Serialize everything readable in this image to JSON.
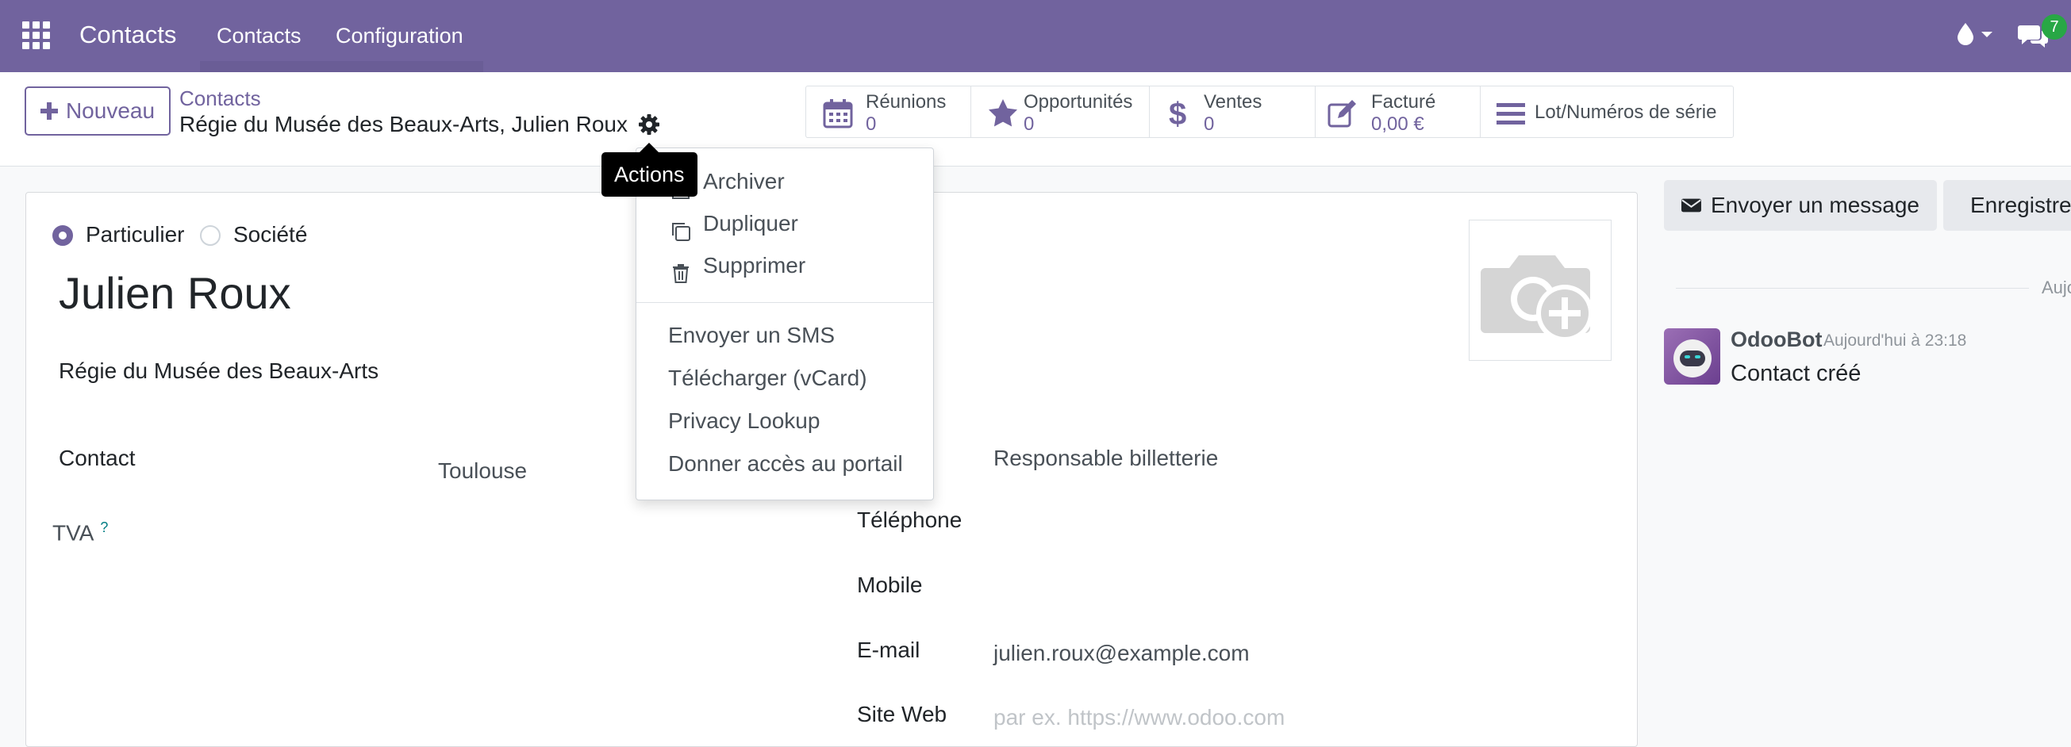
{
  "colors": {
    "brand": "#71639e",
    "text": "#212529",
    "muted": "#6c757d",
    "link": "#71639e"
  },
  "navbar": {
    "apps_icon": "grid-icon",
    "brand": "Contacts",
    "menus": [
      "Contacts",
      "Configuration"
    ],
    "activity_icon": "drop-icon",
    "messages_icon": "chat-icon",
    "messages_count": "7"
  },
  "control": {
    "new_label": "Nouveau",
    "breadcrumb_parent": "Contacts",
    "breadcrumb_current": "Régie du Musée des Beaux-Arts, Julien Roux",
    "gear_icon": "gear-icon",
    "smart_buttons": [
      {
        "label": "Réunions",
        "value": "0",
        "icon": "calendar-icon"
      },
      {
        "label": "Opportunités",
        "value": "0",
        "icon": "star-icon"
      },
      {
        "label": "Ventes",
        "value": "0",
        "icon": "dollar-icon"
      },
      {
        "label": "Facturé",
        "value": "0,00 €",
        "icon": "edit-icon"
      },
      {
        "label": "Lot/Numéros de série",
        "value": "",
        "icon": "list-icon"
      }
    ]
  },
  "tooltip": "Actions",
  "actions_menu": {
    "items": [
      "Archiver",
      "Dupliquer",
      "Supprimer"
    ],
    "items2": [
      "Envoyer un SMS",
      "Télécharger (vCard)",
      "Privacy Lookup",
      "Donner accès au portail"
    ]
  },
  "form": {
    "type_options": [
      "Particulier",
      "Société"
    ],
    "name": "Julien Roux",
    "company": "Régie du Musée des Beaux-Arts",
    "address_label": "Contact",
    "city": "Toulouse",
    "vat_label": "TVA",
    "vat_help": "?",
    "job_value": "Responsable billetterie",
    "phone_label": "Téléphone",
    "mobile_label": "Mobile",
    "email_label": "E-mail",
    "email_value": "julien.roux@example.com",
    "website_label": "Site Web",
    "website_placeholder": "par ex. https://www.odoo.com"
  },
  "chatter": {
    "send_message": "Envoyer un message",
    "log_note": "Enregistrer une note",
    "today": "Aujourd'hui",
    "author": "OdooBot",
    "date": "Aujourd'hui à 23:18",
    "body": "Contact créé"
  }
}
